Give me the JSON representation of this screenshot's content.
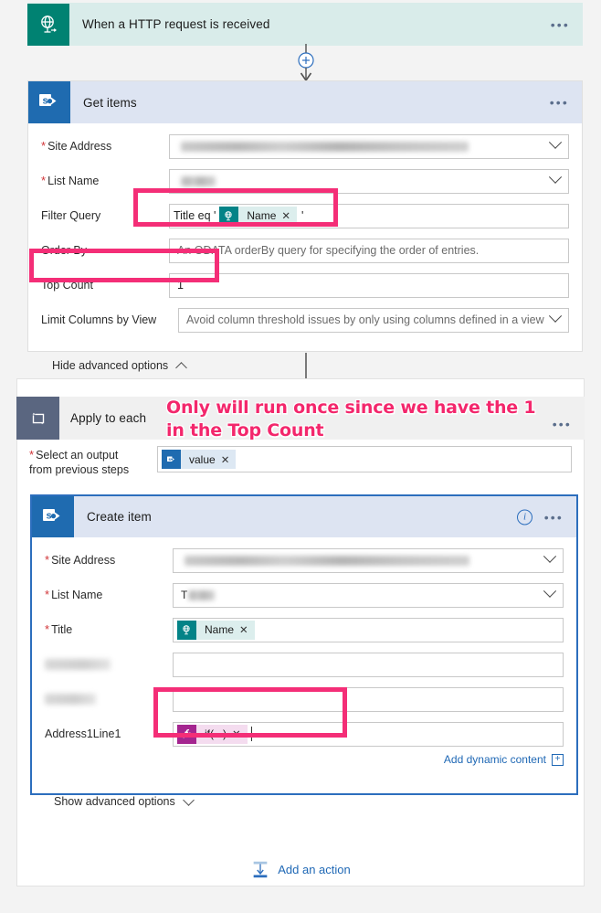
{
  "flow": {
    "trigger": {
      "title": "When a HTTP request is received",
      "icon": "http-globe-icon",
      "header_bg": "#d9ecea",
      "icon_bg": "#008272",
      "menu": "•••"
    },
    "connector_plus": "+",
    "get_items": {
      "title": "Get items",
      "icon": "sharepoint-icon",
      "header_bg": "#dde4f2",
      "icon_bg": "#1f6bb0",
      "menu": "•••",
      "fields": [
        {
          "label": "Site Address",
          "required": true,
          "value": "",
          "redacted": true,
          "dropdown": true
        },
        {
          "label": "List Name",
          "required": true,
          "value": "",
          "redacted": true,
          "dropdown": true
        },
        {
          "label": "Filter Query",
          "required": false,
          "prefix": "Title eq '",
          "suffix": "'",
          "token": "Name",
          "token_icon": "http-globe-icon",
          "dropdown": false
        },
        {
          "label": "Order By",
          "required": false,
          "value": "An ODATA orderBy query for specifying the order of entries.",
          "placeholder": true,
          "dropdown": false
        },
        {
          "label": "Top Count",
          "required": false,
          "value": "1",
          "dropdown": false
        },
        {
          "label": "Limit Columns by View",
          "required": false,
          "value": "Avoid column threshold issues by only using columns defined in a view",
          "placeholder": true,
          "dropdown": true
        }
      ],
      "advanced_toggle": "Hide advanced options"
    },
    "apply_to_each": {
      "title": "Apply to each",
      "icon": "loop-icon",
      "header_bg": "#f0f0f0",
      "icon_bg": "#5a6680",
      "menu": "•••",
      "select_label_line1": "Select an output",
      "select_label_line2": "from previous steps",
      "select_required": true,
      "select_token": "value",
      "select_token_icon": "sharepoint-icon"
    },
    "create_item": {
      "title": "Create item",
      "icon": "sharepoint-icon",
      "header_bg": "#dde4f2",
      "icon_bg": "#1f6bb0",
      "menu": "•••",
      "info": "i",
      "fields": [
        {
          "label": "Site Address",
          "required": true,
          "value": "",
          "redacted": true,
          "dropdown": true
        },
        {
          "label": "List Name",
          "required": true,
          "value": "",
          "redacted": true,
          "redacted_prefix": "T",
          "dropdown": true
        },
        {
          "label": "Title",
          "required": true,
          "token": "Name",
          "token_icon": "http-globe-icon",
          "dropdown": false
        },
        {
          "label": "",
          "label_redacted": true,
          "value": "",
          "dropdown": false
        },
        {
          "label": "",
          "label_redacted": true,
          "value": "",
          "dropdown": false
        },
        {
          "label": "Address1Line1",
          "required": false,
          "token": "if(...)",
          "token_icon": "fx-icon",
          "dropdown": false
        }
      ],
      "add_dynamic_content": "Add dynamic content",
      "add_dynamic_plus": "+",
      "advanced_toggle": "Show advanced options"
    },
    "add_action": "Add an action"
  },
  "annotation": {
    "line1": "Only will run once since we have the 1",
    "line2": "in the Top Count",
    "color": "#f3276c"
  },
  "highlights": {
    "color": "#f42e77",
    "items": [
      {
        "name": "filter-query-highlight"
      },
      {
        "name": "top-count-highlight"
      },
      {
        "name": "address1line1-highlight"
      }
    ]
  }
}
